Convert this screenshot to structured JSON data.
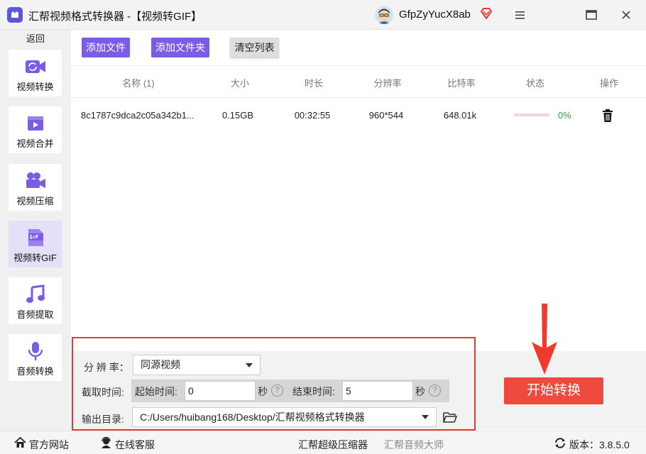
{
  "titlebar": {
    "app_title": "汇帮视频格式转换器  -【视频转GIF】",
    "username": "GfpZyYucX8ab"
  },
  "sidebar": {
    "back_label": "返回",
    "items": [
      {
        "label": "视频转换",
        "icon": "video-convert-icon"
      },
      {
        "label": "视频合并",
        "icon": "video-merge-icon"
      },
      {
        "label": "视频压缩",
        "icon": "video-compress-icon"
      },
      {
        "label": "视频转GIF",
        "icon": "gif-icon",
        "active": true
      },
      {
        "label": "音频提取",
        "icon": "music-note-icon"
      },
      {
        "label": "音频转换",
        "icon": "microphone-icon"
      }
    ]
  },
  "toolbar": {
    "add_file": "添加文件",
    "add_folder": "添加文件夹",
    "clear_list": "清空列表"
  },
  "table": {
    "columns": [
      "名称 (1)",
      "大小",
      "时长",
      "分辨率",
      "比特率",
      "状态",
      "操作"
    ],
    "rows": [
      {
        "name": "8c1787c9dca2c05a342b1...",
        "size": "0.15GB",
        "duration": "00:32:55",
        "resolution": "960*544",
        "bitrate": "648.01k",
        "progress": 0,
        "progress_text": "0%"
      }
    ]
  },
  "settings": {
    "resolution_label": "分 辨 率：",
    "resolution_value": "同源视频",
    "clip_label": "截取时间:",
    "start_label": "起始时间:",
    "start_value": "0",
    "end_label": "结束时间:",
    "end_value": "5",
    "sec_unit": "秒",
    "help_glyph": "?",
    "output_label": "输出目录:",
    "output_path": "C:/Users/huibang168/Desktop/汇帮视频格式转换器"
  },
  "start_button": "开始转换",
  "footer": {
    "website": "官方网站",
    "support": "在线客服",
    "compressor": "汇帮超级压缩器",
    "audio_master": "汇帮音频大师",
    "version": "版本：3.8.5.0"
  },
  "colors": {
    "accent": "#7b5ce6",
    "start": "#f04a3e",
    "highlight_box": "#e53935",
    "progress_text": "#3a9d3a"
  }
}
